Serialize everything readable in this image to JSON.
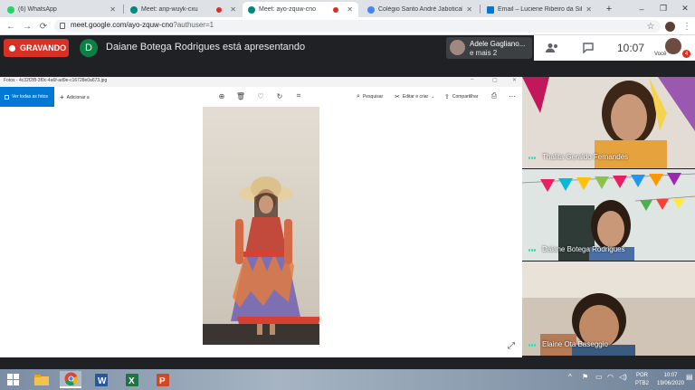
{
  "browser": {
    "tabs": [
      {
        "title": "(6) WhatsApp",
        "favicon_color": "#25d366",
        "recording": false,
        "active": false
      },
      {
        "title": "Meet: anp-wuyk-cxu",
        "favicon_color": "#00897b",
        "recording": true,
        "active": false
      },
      {
        "title": "Meet: ayo-zquw-cno",
        "favicon_color": "#00897b",
        "recording": true,
        "active": true
      },
      {
        "title": "Colégio Santo André Jaboticaba",
        "favicon_color": "#4285f4",
        "recording": false,
        "active": false
      },
      {
        "title": "Email – Luciene Ribeiro da Silva",
        "favicon_color": "#0078d4",
        "recording": false,
        "active": false
      }
    ],
    "new_tab": "+",
    "url_host": "meet.google.com/ayo-zquw-cno",
    "url_query": "?authuser=1"
  },
  "meet": {
    "recording_label": "GRAVANDO",
    "presenter_initial": "D",
    "presenting_text": "Daiane Botega Rodrigues está apresentando",
    "participants_name": "Adele Gagliano...",
    "participants_more": "e mais 2",
    "clock": "10:07",
    "self_label": "Você",
    "notification_count": "4",
    "colors": {
      "recording": "#d93025",
      "presenter_avatar": "#0b8043",
      "background": "#202124"
    }
  },
  "photos": {
    "file_title": "Fotos - 4c32f2f8-3f0c-4a6f-ad9e-c16728e0a673.jpg",
    "see_all": "Ver todas as fotos",
    "add": "Adicionar a",
    "search": "Pesquisar",
    "edit": "Editar e criar",
    "share": "Compartilhar"
  },
  "tiles": [
    {
      "name": "Thalita Geraldo Fernandes"
    },
    {
      "name": "Daiane Botega Rodrigues"
    },
    {
      "name": "Elaine Ota Baseggio"
    }
  ],
  "taskbar": {
    "apps": [
      "windows-start",
      "file-explorer",
      "chrome",
      "word",
      "excel",
      "powerpoint"
    ],
    "language": "POR",
    "layout": "PTB2",
    "time": "10:07",
    "date": "19/06/2020"
  }
}
